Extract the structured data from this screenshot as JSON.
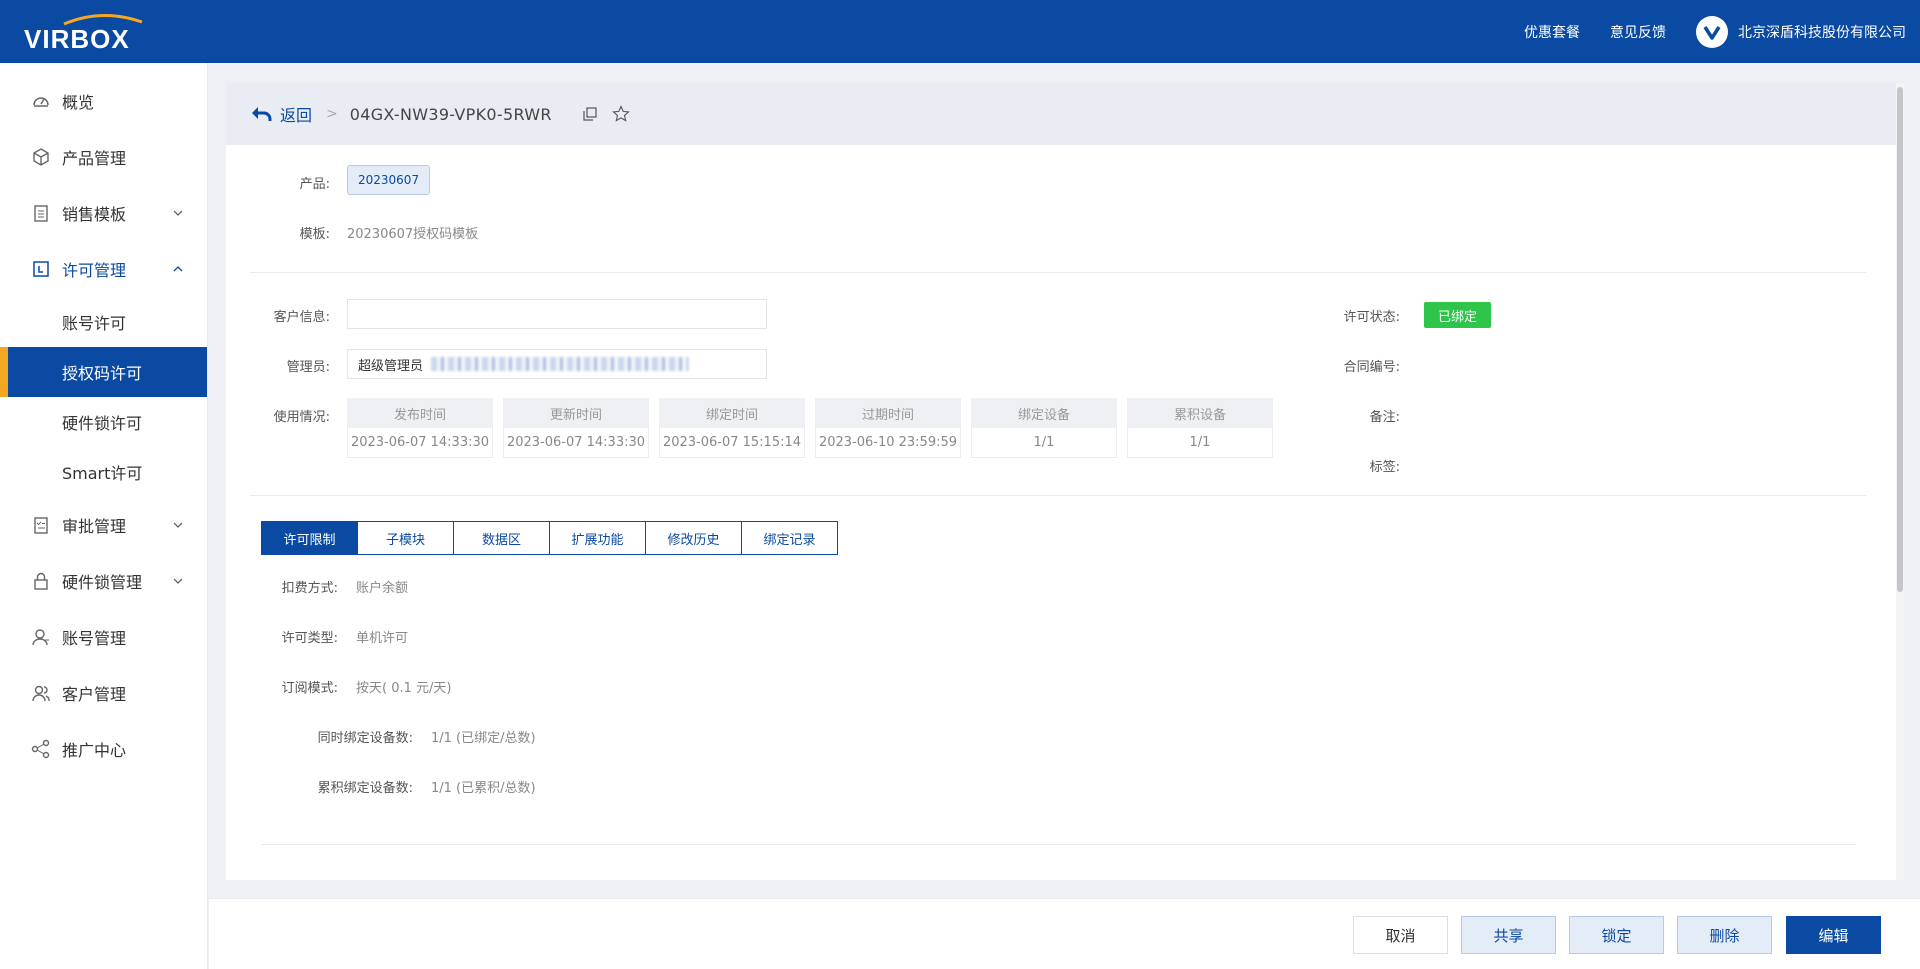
{
  "header": {
    "logo_text": "VIRBOX",
    "links": [
      "优惠套餐",
      "意见反馈"
    ],
    "company": "北京深盾科技股份有限公司"
  },
  "sidebar": {
    "items": [
      {
        "label": "概览",
        "icon": "dashboard-icon"
      },
      {
        "label": "产品管理",
        "icon": "cube-icon"
      },
      {
        "label": "销售模板",
        "icon": "clipboard-icon",
        "expandable": true
      },
      {
        "label": "许可管理",
        "icon": "license-icon",
        "expanded": true
      },
      {
        "label": "审批管理",
        "icon": "checklist-icon",
        "expandable": true
      },
      {
        "label": "硬件锁管理",
        "icon": "lock-icon",
        "expandable": true
      },
      {
        "label": "账号管理",
        "icon": "user-icon"
      },
      {
        "label": "客户管理",
        "icon": "customers-icon"
      },
      {
        "label": "推广中心",
        "icon": "share-icon"
      }
    ],
    "license_sub": [
      "账号许可",
      "授权码许可",
      "硬件锁许可",
      "Smart许可"
    ],
    "active_sub": "授权码许可"
  },
  "breadcrumb": {
    "back": "返回",
    "license_id": "04GX-NW39-VPK0-5RWR"
  },
  "info": {
    "product_label": "产品:",
    "product_value": "20230607",
    "template_label": "模板:",
    "template_value": "20230607授权码模板",
    "customer_label": "客户信息:",
    "customer_value": "",
    "admin_label": "管理员:",
    "admin_value": "超级管理员",
    "usage_label": "使用情况:",
    "status_label": "许可状态:",
    "status_value": "已绑定",
    "contract_label": "合同编号:",
    "remark_label": "备注:",
    "tag_label": "标签:"
  },
  "usage": [
    {
      "head": "发布时间",
      "value": "2023-06-07 14:33:30"
    },
    {
      "head": "更新时间",
      "value": "2023-06-07 14:33:30"
    },
    {
      "head": "绑定时间",
      "value": "2023-06-07 15:15:14"
    },
    {
      "head": "过期时间",
      "value": "2023-06-10 23:59:59"
    },
    {
      "head": "绑定设备",
      "value": "1/1"
    },
    {
      "head": "累积设备",
      "value": "1/1"
    }
  ],
  "tabs": [
    "许可限制",
    "子模块",
    "数据区",
    "扩展功能",
    "修改历史",
    "绑定记录"
  ],
  "limits": {
    "billing_label": "扣费方式:",
    "billing_value": "账户余额",
    "type_label": "许可类型:",
    "type_value": "单机许可",
    "sub_label": "订阅模式:",
    "sub_value": "按天( 0.1 元/天)",
    "concurrent_label": "同时绑定设备数:",
    "concurrent_value": "1/1 (已绑定/总数)",
    "cumulative_label": "累积绑定设备数:",
    "cumulative_value": "1/1 (已累积/总数)"
  },
  "footer": {
    "cancel": "取消",
    "share": "共享",
    "lock": "锁定",
    "delete": "删除",
    "edit": "编辑"
  },
  "colors": {
    "brand": "#0b4aa2",
    "accent": "#f5a623",
    "status_green": "#2fc44a"
  }
}
